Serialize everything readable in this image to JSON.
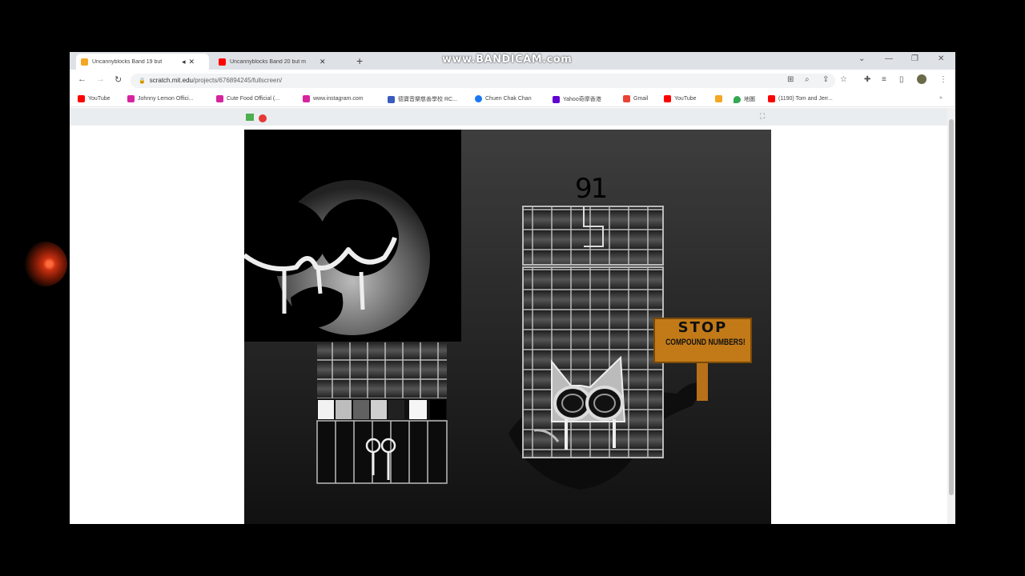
{
  "browser": {
    "tabs": [
      {
        "title": "Uncannyblocks Band 19 but",
        "active": true,
        "icon": "scratch-icon",
        "color": "#f5a623"
      },
      {
        "title": "Uncannyblocks Band 20 but m",
        "active": false,
        "icon": "youtube-icon",
        "color": "#ff0000"
      }
    ],
    "watermark": "www.BANDICAM.com",
    "url_host": "scratch.mit.edu",
    "url_path": "/projects/676894245/fullscreen/"
  },
  "bookmarks": [
    {
      "label": "YouTube",
      "icon": "youtube-icon",
      "color": "#ff0000"
    },
    {
      "label": "Johnny Lemon Offici...",
      "icon": "instagram-icon",
      "color": "#d6249f"
    },
    {
      "label": "Cute Food Official (...",
      "icon": "instagram-icon",
      "color": "#d6249f"
    },
    {
      "label": "www.instagram.com",
      "icon": "instagram-icon",
      "color": "#d6249f"
    },
    {
      "label": "德寶音樂慈善學校 RC...",
      "icon": "site-icon",
      "color": "#3a5bbf"
    },
    {
      "label": "Chuen Chak Chan",
      "icon": "facebook-icon",
      "color": "#1877f2"
    },
    {
      "label": "Yahoo奇摩香港",
      "icon": "yahoo-icon",
      "color": "#6001d2"
    },
    {
      "label": "Gmail",
      "icon": "gmail-icon",
      "color": "#ea4335"
    },
    {
      "label": "YouTube",
      "icon": "youtube-icon",
      "color": "#ff0000"
    },
    {
      "label": "",
      "icon": "scratch-icon",
      "color": "#f5a623"
    },
    {
      "label": "地圖",
      "icon": "maps-icon",
      "color": "#34a853"
    },
    {
      "label": "(1190) Tom and Jerr...",
      "icon": "youtube-icon",
      "color": "#ff0000"
    }
  ],
  "stage": {
    "number_label": "91",
    "sign_line1": "STOP",
    "sign_line2": "COMPOUND NUMBERS!",
    "sign_color": "#c27a18"
  }
}
